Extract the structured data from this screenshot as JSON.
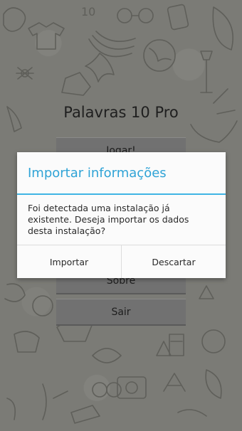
{
  "app": {
    "title": "Palavras 10 Pro"
  },
  "menu": {
    "play_label": "Jogar!",
    "about_label": "Sobre",
    "exit_label": "Sair"
  },
  "dialog": {
    "title": "Importar informações",
    "message": "Foi detectada uma instalação já existente. Deseja importar os dados desta instalação?",
    "import_label": "Importar",
    "discard_label": "Descartar"
  },
  "background": {
    "corner_mark": "10"
  },
  "colors": {
    "accent": "#33b5e5",
    "background": "#7b7b76",
    "button": "#717171",
    "dialog_bg": "#fbfbfb"
  }
}
